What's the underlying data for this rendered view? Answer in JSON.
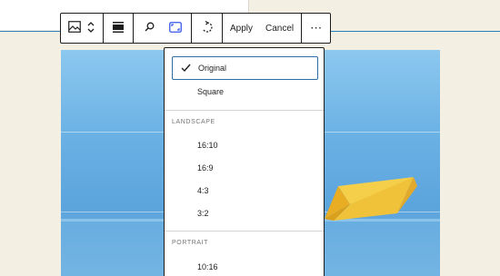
{
  "toolbar": {
    "apply_label": "Apply",
    "cancel_label": "Cancel",
    "more_label": "⋯"
  },
  "aspect_menu": {
    "selected_label": "Original",
    "items_top": [
      "Original",
      "Square"
    ],
    "landscape_heading": "LANDSCAPE",
    "landscape": [
      "16:10",
      "16:9",
      "4:3",
      "3:2"
    ],
    "portrait_heading": "PORTRAIT",
    "portrait": [
      "10:16"
    ]
  },
  "colors": {
    "accent": "#3858e9",
    "selection_border": "#2c6fa8",
    "boat": "#f0c23a"
  }
}
